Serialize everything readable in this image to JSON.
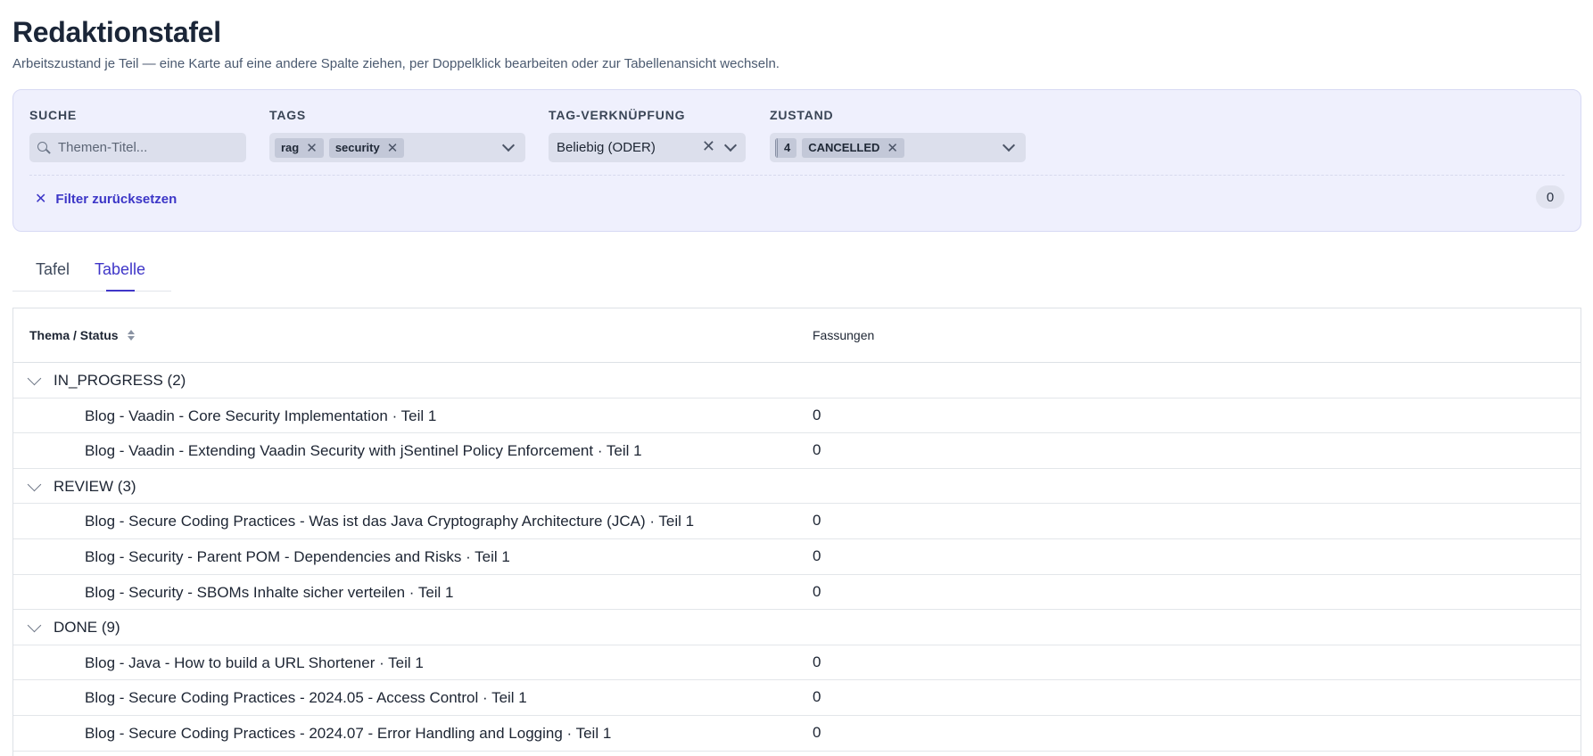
{
  "header": {
    "title": "Redaktionstafel",
    "subtitle": "Arbeitszustand je Teil — eine Karte auf eine andere Spalte ziehen, per Doppelklick bearbeiten oder zur Tabellenansicht wechseln."
  },
  "filters": {
    "search": {
      "label": "SUCHE",
      "placeholder": "Themen-Titel...",
      "icon": "search-icon"
    },
    "tags": {
      "label": "TAGS",
      "selected": [
        "rag",
        "security"
      ]
    },
    "tag_link": {
      "label": "TAG-VERKNÜPFUNG",
      "value": "Beliebig (ODER)"
    },
    "state": {
      "label": "ZUSTAND",
      "count": "4",
      "selected": "CANCELLED"
    },
    "reset_label": "Filter zurücksetzen",
    "result_count": "0"
  },
  "tabs": [
    {
      "label": "Tafel",
      "active": false
    },
    {
      "label": "Tabelle",
      "active": true
    }
  ],
  "table": {
    "columns": [
      "Thema / Status",
      "Fassungen"
    ],
    "groups": [
      {
        "label": "IN_PROGRESS (2)",
        "items": [
          {
            "title": "Blog - Vaadin - Core Security Implementation · Teil 1",
            "count": "0"
          },
          {
            "title": "Blog - Vaadin - Extending Vaadin Security with jSentinel Policy Enforcement · Teil 1",
            "count": "0"
          }
        ]
      },
      {
        "label": "REVIEW (3)",
        "items": [
          {
            "title": "Blog - Secure Coding Practices - Was ist das Java Cryptography Architecture (JCA) · Teil 1",
            "count": "0"
          },
          {
            "title": "Blog - Security - Parent POM - Dependencies and Risks · Teil 1",
            "count": "0"
          },
          {
            "title": "Blog - Security - SBOMs Inhalte sicher verteilen · Teil 1",
            "count": "0"
          }
        ]
      },
      {
        "label": "DONE (9)",
        "items": [
          {
            "title": "Blog - Java - How to build a URL Shortener · Teil 1",
            "count": "0"
          },
          {
            "title": "Blog - Secure Coding Practices - 2024.05 - Access Control · Teil 1",
            "count": "0"
          },
          {
            "title": "Blog - Secure Coding Practices - 2024.07 - Error Handling and Logging · Teil 1",
            "count": "0"
          }
        ]
      }
    ]
  },
  "colors": {
    "accent": "#3f36c8",
    "panel_bg": "#eff0fd",
    "chip_bg": "#c3c8d8"
  }
}
